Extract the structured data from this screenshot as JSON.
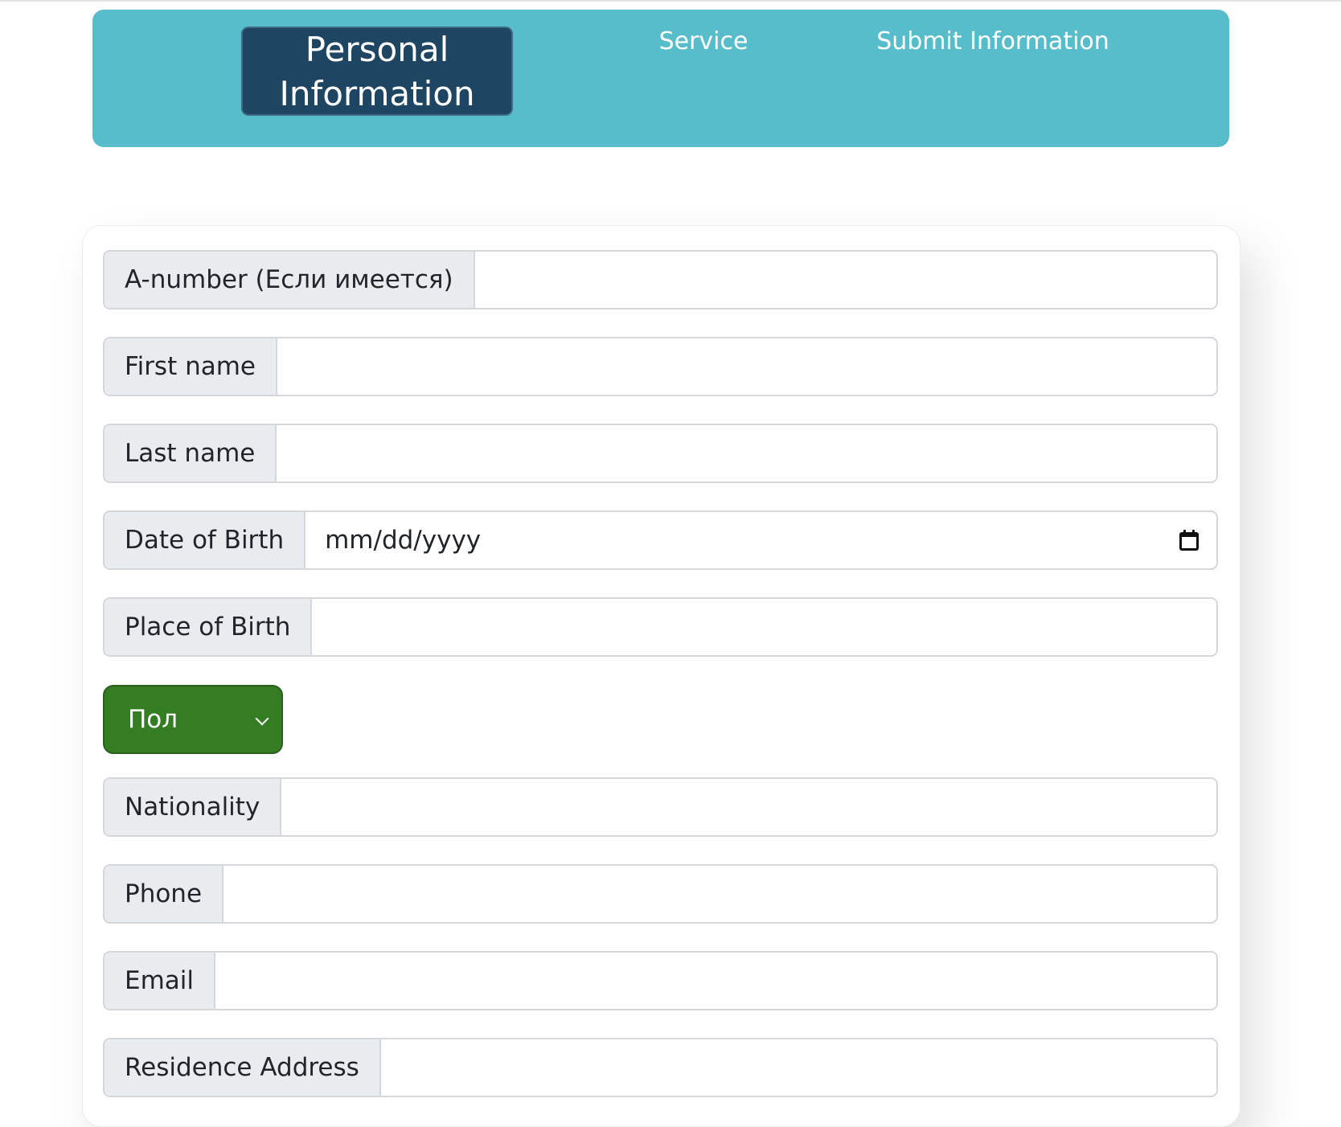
{
  "nav": {
    "tabs": [
      {
        "label": "Personal Information",
        "active": true
      },
      {
        "label": "Service",
        "active": false
      },
      {
        "label": "Submit Information",
        "active": false
      }
    ]
  },
  "form": {
    "a_number": {
      "label": "A-number (Если имеется)",
      "value": ""
    },
    "first_name": {
      "label": "First name",
      "value": ""
    },
    "last_name": {
      "label": "Last name",
      "value": ""
    },
    "date_of_birth": {
      "label": "Date of Birth",
      "placeholder": "mm/dd/yyyy",
      "icon": "calendar-icon"
    },
    "place_of_birth": {
      "label": "Place of Birth",
      "value": ""
    },
    "gender": {
      "selected": "Пол",
      "icon": "chevron-down-icon"
    },
    "nationality": {
      "label": "Nationality",
      "value": ""
    },
    "phone": {
      "label": "Phone",
      "value": ""
    },
    "email": {
      "label": "Email",
      "value": ""
    },
    "residence_address": {
      "label": "Residence Address",
      "value": ""
    }
  },
  "colors": {
    "nav_background": "#58bdca",
    "nav_active_tab": "#1e4562",
    "gender_select": "#357d22",
    "label_background": "#e9ecef"
  }
}
